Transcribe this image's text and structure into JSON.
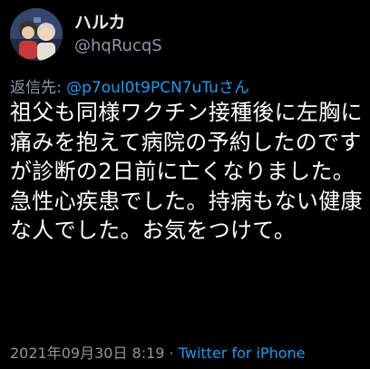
{
  "user": {
    "display_name": "ハルカ",
    "handle": "@hqRucqS"
  },
  "reply": {
    "prefix": "返信先: ",
    "mention": "@p7oul0t9PCN7uTuさん"
  },
  "tweet": {
    "text": "祖父も同様ワクチン接種後に左胸に痛みを抱えて病院の予約したのですが診断の2日前に亡くなりました。急性心疾患でした。持病もない健康な人でした。お気をつけて。"
  },
  "meta": {
    "timestamp": "2021年09月30日 8:19",
    "separator": " · ",
    "source": "Twitter for iPhone"
  },
  "colors": {
    "background": "#000000",
    "text_primary": "#ffffff",
    "text_secondary": "#8b98a5",
    "link": "#1d9bf0"
  },
  "icons": {
    "avatar": "profile-avatar"
  }
}
